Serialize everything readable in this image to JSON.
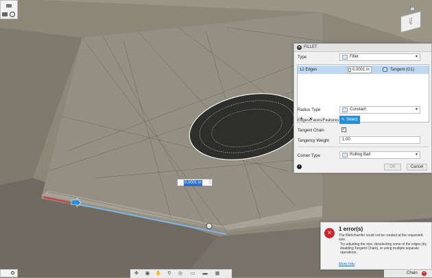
{
  "panel": {
    "title": "FILLET",
    "type_label": "Type",
    "type_value": "Fillet",
    "edges_label": "12 Edges",
    "radius_value": "0.0001 in",
    "continuity": "Tangent (G1)",
    "radius_type_label": "Radius Type",
    "radius_type_value": "Constant",
    "edges_faces_label": "Edges/Faces/Features",
    "select_label": "Select",
    "tangent_chain_label": "Tangent Chain",
    "tangent_chain_checked": true,
    "tangency_weight_label": "Tangency Weight",
    "tangency_weight_value": "1.00",
    "corner_type_label": "Corner Type",
    "corner_type_value": "Rolling Ball",
    "ok_label": "OK",
    "cancel_label": "Cancel"
  },
  "viewport": {
    "inline_input_value": "0.0001 in",
    "inline_menu": "⋮"
  },
  "error": {
    "title": "1 error(s)",
    "line1": "The fillet/chamfer could not be created at the requested size.",
    "line2": "Try adjusting the size, deselecting some of the edges (try disabling Tangent Chain), or using multiple separate operations.",
    "more_info": "More Info"
  },
  "status": {
    "chain_label": "Chain"
  },
  "view_cube_label": "TOP",
  "colors": {
    "accent": "#2a8fd6",
    "error": "#c8282e",
    "edge_selected": "#7fb6ea"
  }
}
